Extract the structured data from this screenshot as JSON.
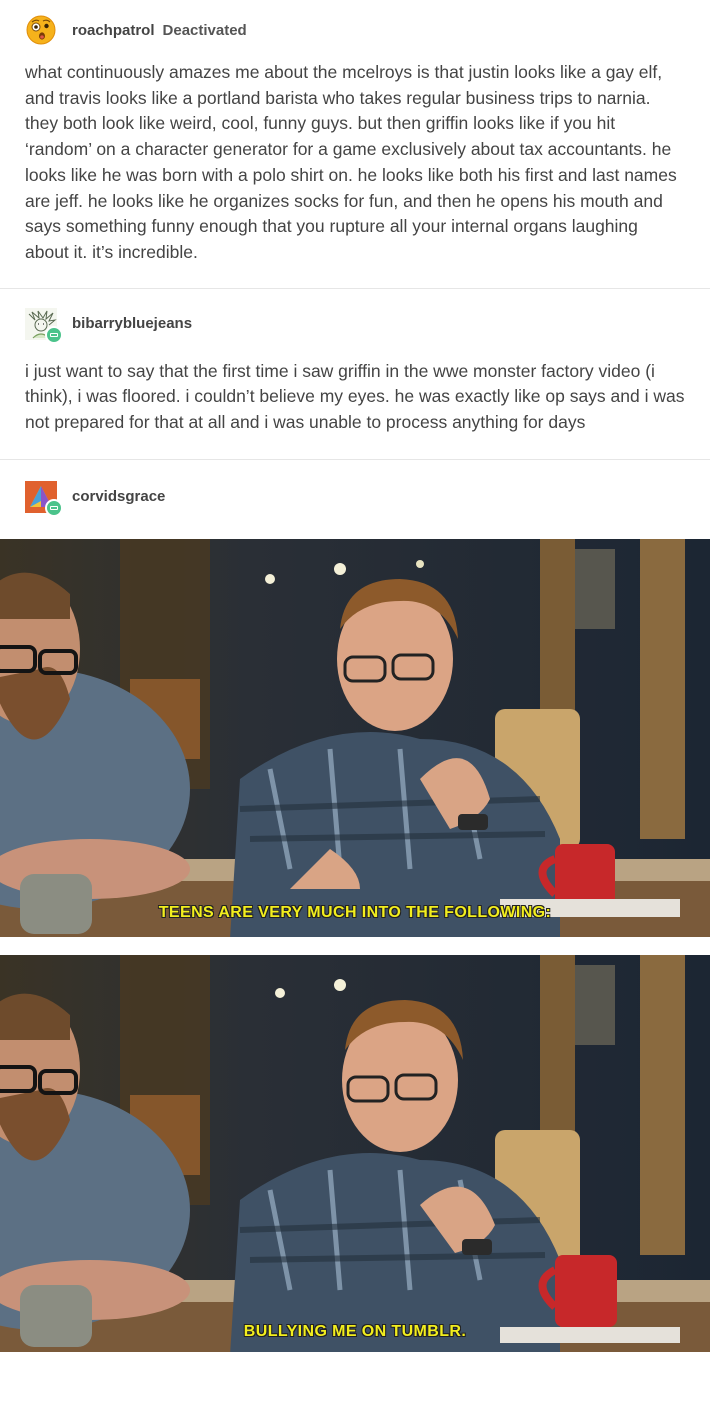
{
  "posts": [
    {
      "username": "roachpatrol",
      "status": "Deactivated",
      "avatar_icon": "surprised-emoji-icon",
      "text": "what continuously amazes me about the mcelroys is that justin looks like a gay elf, and travis looks like a portland barista who takes regular business trips to narnia. they both look like weird, cool, funny guys. but then griffin looks like if you hit ‘random’ on a character generator for a game exclusively about tax accountants. he looks like he was born with a polo shirt on. he looks like both his first and last names are jeff. he looks like he organizes socks for fun, and then he opens his mouth and says something funny enough that you rupture all your internal organs laughing about it. it’s incredible."
    },
    {
      "username": "bibarrybluejeans",
      "avatar_icon": "sketch-avatar-icon",
      "text": "i just want to say that the first time i saw griffin in the wwe monster factory video (i think), i was floored. i couldn’t believe my eyes. he was exactly like op says and i was not prepared for that at all and i was unable to process anything for days"
    },
    {
      "username": "corvidsgrace",
      "avatar_icon": "triangle-avatar-icon",
      "frames": [
        {
          "caption": "TEENS ARE VERY MUCH INTO THE FOLLOWING:"
        },
        {
          "caption": "BULLYING ME ON TUMBLR."
        }
      ]
    }
  ],
  "colors": {
    "text": "#444444",
    "divider": "#e6e6e6",
    "reblog_badge": "#4bc38b",
    "subtitle": "#f2ee1e"
  }
}
